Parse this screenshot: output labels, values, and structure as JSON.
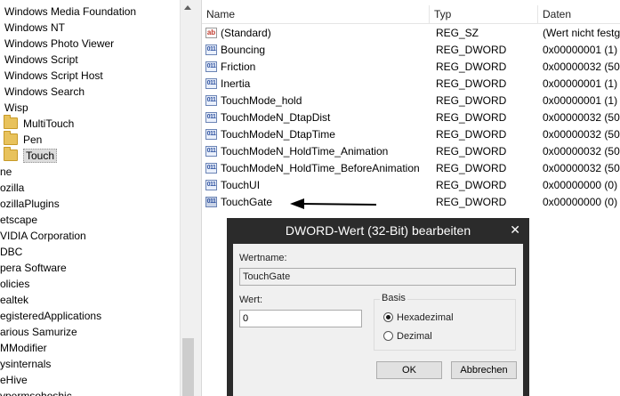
{
  "tree": {
    "items": [
      {
        "label": "Windows Media Foundation"
      },
      {
        "label": "Windows NT"
      },
      {
        "label": "Windows Photo Viewer"
      },
      {
        "label": "Windows Script"
      },
      {
        "label": "Windows Script Host"
      },
      {
        "label": "Windows Search"
      },
      {
        "label": "Wisp"
      },
      {
        "label": "MultiTouch"
      },
      {
        "label": "Pen"
      },
      {
        "label": "Touch"
      },
      {
        "label": "ne"
      },
      {
        "label": "ozilla"
      },
      {
        "label": "ozillaPlugins"
      },
      {
        "label": "etscape"
      },
      {
        "label": "VIDIA Corporation"
      },
      {
        "label": "DBC"
      },
      {
        "label": "pera Software"
      },
      {
        "label": "olicies"
      },
      {
        "label": "ealtek"
      },
      {
        "label": "egisteredApplications"
      },
      {
        "label": "arious Samurize"
      },
      {
        "label": "MModifier"
      },
      {
        "label": "ysinternals"
      },
      {
        "label": "eHive"
      },
      {
        "label": "ypermsohoshic"
      }
    ]
  },
  "list": {
    "headers": {
      "name": "Name",
      "type": "Typ",
      "data": "Daten"
    },
    "rows": [
      {
        "icon": "string-value-icon",
        "name": "(Standard)",
        "type": "REG_SZ",
        "data": "(Wert nicht festg"
      },
      {
        "icon": "dword-value-icon",
        "name": "Bouncing",
        "type": "REG_DWORD",
        "data": "0x00000001 (1)"
      },
      {
        "icon": "dword-value-icon",
        "name": "Friction",
        "type": "REG_DWORD",
        "data": "0x00000032 (50)"
      },
      {
        "icon": "dword-value-icon",
        "name": "Inertia",
        "type": "REG_DWORD",
        "data": "0x00000001 (1)"
      },
      {
        "icon": "dword-value-icon",
        "name": "TouchMode_hold",
        "type": "REG_DWORD",
        "data": "0x00000001 (1)"
      },
      {
        "icon": "dword-value-icon",
        "name": "TouchModeN_DtapDist",
        "type": "REG_DWORD",
        "data": "0x00000032 (50)"
      },
      {
        "icon": "dword-value-icon",
        "name": "TouchModeN_DtapTime",
        "type": "REG_DWORD",
        "data": "0x00000032 (50)"
      },
      {
        "icon": "dword-value-icon",
        "name": "TouchModeN_HoldTime_Animation",
        "type": "REG_DWORD",
        "data": "0x00000032 (50)"
      },
      {
        "icon": "dword-value-icon",
        "name": "TouchModeN_HoldTime_BeforeAnimation",
        "type": "REG_DWORD",
        "data": "0x00000032 (50)"
      },
      {
        "icon": "dword-value-icon",
        "name": "TouchUI",
        "type": "REG_DWORD",
        "data": "0x00000000 (0)"
      },
      {
        "icon": "dword-value-icon",
        "name": "TouchGate",
        "type": "REG_DWORD",
        "data": "0x00000000 (0)"
      }
    ]
  },
  "dialog": {
    "title": "DWORD-Wert (32-Bit) bearbeiten",
    "close_glyph": "✕",
    "name_label": "Wertname:",
    "name_value": "TouchGate",
    "value_label": "Wert:",
    "value_value": "0",
    "basis_label": "Basis",
    "radio_hex": "Hexadezimal",
    "radio_dec": "Dezimal",
    "selected_basis": "Hexadezimal",
    "ok_label": "OK",
    "cancel_label": "Abbrechen"
  },
  "colors": {
    "dialog_frame": "#2b2b2b",
    "dialog_body": "#f0f0f0",
    "folder": "#e8c25c"
  }
}
